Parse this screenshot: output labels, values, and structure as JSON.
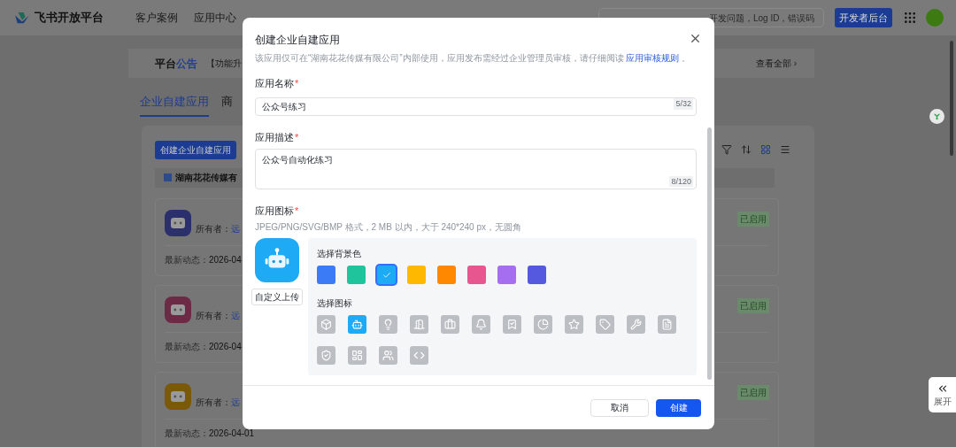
{
  "header": {
    "logo": "飞书开放平台",
    "nav": [
      "客户案例",
      "应用中心"
    ],
    "search": {
      "placeholder": "开发问题，Log ID，错误码"
    },
    "console_button": "开发者后台"
  },
  "notice": {
    "title_plain": "平台",
    "title_accent": "公告",
    "text": "【功能升",
    "view_all": "查看全部 ›"
  },
  "tabs": [
    {
      "label": "企业自建应用",
      "selected": true
    },
    {
      "label": "商",
      "selected": false
    }
  ],
  "create_button": "创建企业自建应用",
  "company": "湖南花花传媒有",
  "toolbar": [
    {
      "kind": "filter",
      "selected": false
    },
    {
      "kind": "sort",
      "selected": false
    },
    {
      "kind": "grid",
      "selected": true
    },
    {
      "kind": "list",
      "selected": false
    }
  ],
  "apps": [
    {
      "color": "#2b2f6c",
      "owner_label": "所有者：",
      "owner": "远",
      "latest_label": "最新动态：",
      "latest": "2026-04",
      "status": "已启用"
    },
    {
      "color": "#6c2a44",
      "owner_label": "所有者：",
      "owner": "远",
      "latest_label": "最新动态：",
      "latest": "2026-04",
      "status": "已启用"
    },
    {
      "color": "#7a5a0a",
      "owner_label": "所有者：",
      "owner": "远",
      "latest_label": "最新动态：",
      "latest": "2026-04-01",
      "status": "已启用"
    }
  ],
  "side_panel": {
    "label": "展开"
  },
  "dialog": {
    "title": "创建企业自建应用",
    "description": "该应用仅可在“湖南花花传媒有限公司”内部使用，应用发布需经过企业管理员审核，请仔细阅读",
    "rules_link": "应用审核规则",
    "description_end": "。",
    "name": {
      "label": "应用名称",
      "required_mark": "*",
      "value": "公众号练习",
      "count": "5/32"
    },
    "desc": {
      "label": "应用描述",
      "required_mark": "*",
      "value": "公众号自动化练习",
      "count": "8/120"
    },
    "icon": {
      "label": "应用图标",
      "required_mark": "*",
      "hint": "JPEG/PNG/SVG/BMP 格式，2 MB 以内，大于 240*240 px，无圆角",
      "upload_button": "自定义上传",
      "bg_title": "选择背景色",
      "bg_colors": [
        {
          "color": "#3b7cf6",
          "selected": false
        },
        {
          "color": "#1fc49d",
          "selected": false
        },
        {
          "color": "#1eaaf5",
          "selected": true
        },
        {
          "color": "#ffb800",
          "selected": false
        },
        {
          "color": "#ff8800",
          "selected": false
        },
        {
          "color": "#e8568f",
          "selected": false
        },
        {
          "color": "#a56ef0",
          "selected": false
        },
        {
          "color": "#5559e0",
          "selected": false
        }
      ],
      "icon_title": "选择图标",
      "icons": [
        {
          "selected": false
        },
        {
          "selected": true
        },
        {
          "selected": false
        },
        {
          "selected": false
        },
        {
          "selected": false
        },
        {
          "selected": false
        },
        {
          "selected": false
        },
        {
          "selected": false
        },
        {
          "selected": false
        },
        {
          "selected": false
        },
        {
          "selected": false
        },
        {
          "selected": false
        },
        {
          "selected": false
        },
        {
          "selected": false
        },
        {
          "selected": false
        },
        {
          "selected": false
        }
      ]
    },
    "cancel": "取消",
    "create": "创建"
  }
}
